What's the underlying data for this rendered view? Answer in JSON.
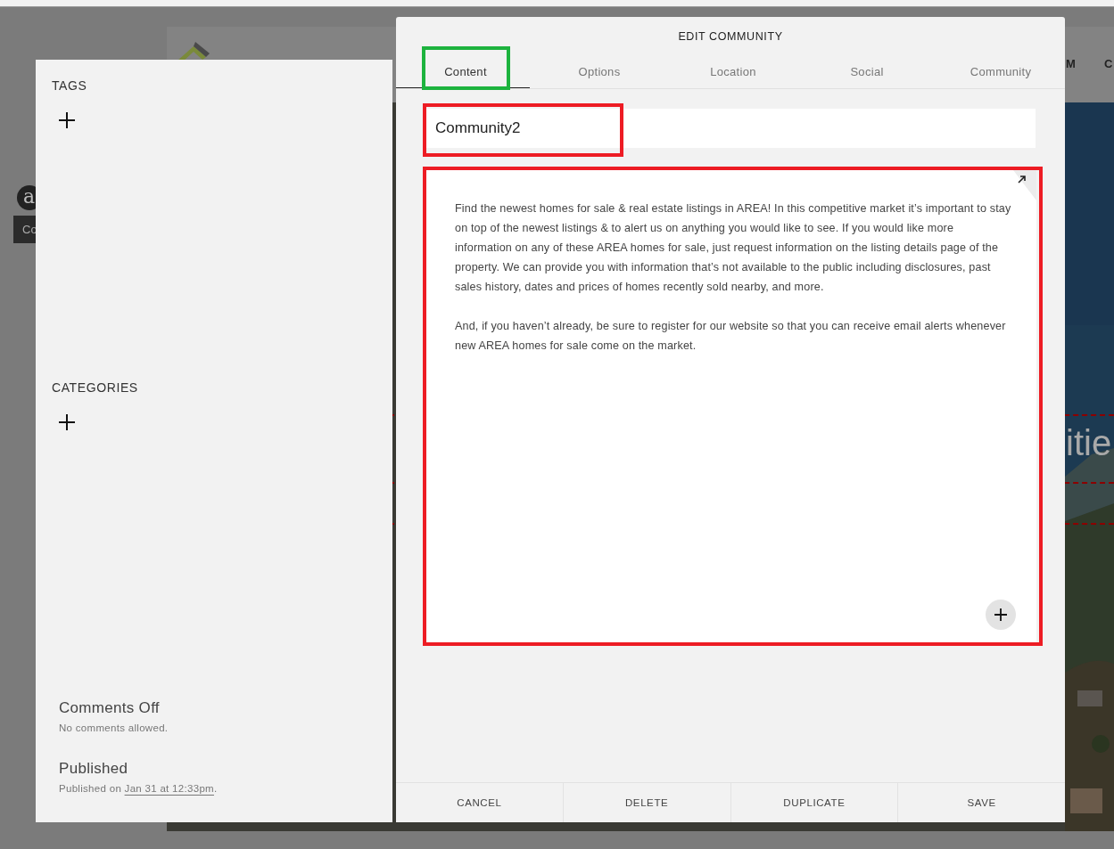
{
  "background": {
    "nav": [
      "M",
      "C"
    ],
    "avatar": "a",
    "badge": "Co",
    "hero_text": "itie"
  },
  "sidebar": {
    "sections": [
      {
        "heading": "TAGS"
      },
      {
        "heading": "CATEGORIES"
      }
    ],
    "comments": {
      "title": "Comments Off",
      "note": "No comments allowed."
    },
    "published": {
      "title": "Published",
      "prefix": "Published on ",
      "date": "Jan 31 at 12:33pm",
      "suffix": "."
    }
  },
  "dialog": {
    "title": "EDIT COMMUNITY",
    "tabs": [
      {
        "label": "Content",
        "selected": true
      },
      {
        "label": "Options",
        "selected": false
      },
      {
        "label": "Location",
        "selected": false
      },
      {
        "label": "Social",
        "selected": false
      },
      {
        "label": "Community",
        "selected": false
      }
    ],
    "title_field": {
      "value": "Community2"
    },
    "body": [
      "Find the newest homes for sale & real estate listings in AREA!  In this competitive market it’s important to stay on top of the newest listings & to alert us on anything you would like to see.  If you would like more information on any of these AREA  homes for sale, just request information on the listing details page of the property. We can provide you with information that’s not available to the public including disclosures, past sales history, dates and prices of homes recently sold nearby, and more.",
      "And, if you haven’t already, be sure to register for our website so that you can receive email alerts whenever new AREA homes for sale come on the market."
    ],
    "buttons": [
      "CANCEL",
      "DELETE",
      "DUPLICATE",
      "SAVE"
    ]
  },
  "annotations": [
    {
      "color": "#1db33e"
    },
    {
      "color": "#ed1c24"
    },
    {
      "color": "#ed1c24"
    }
  ]
}
